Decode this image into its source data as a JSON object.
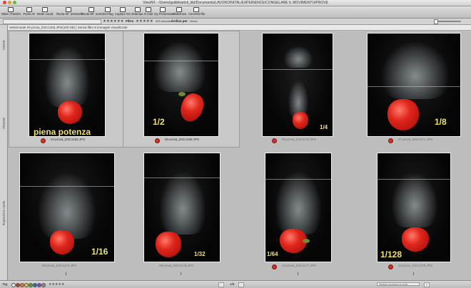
{
  "window": {
    "title": "ViewNX - /Users/guidebartoli_kbt/Documents/LAVORO/NITAL/EXPERIENCE/CONGELARE IL MOVIMENTO/PROVE"
  },
  "toolbar": {
    "buttons": [
      {
        "label": "Nikon Transfer",
        "icon": "transfer-icon"
      },
      {
        "label": "Punto AF",
        "icon": "af-point-icon"
      },
      {
        "label": "Mette vocali",
        "icon": "voice-memo-icon"
      },
      {
        "label": "Ruota 90° antiorario",
        "icon": "rotate-left-icon"
      },
      {
        "label": "Ruota 90° orario",
        "icon": "rotate-right-icon"
      },
      {
        "label": "GeoTag",
        "icon": "geotag-icon"
      },
      {
        "label": "Capture NX 2",
        "icon": "capture-nx-icon"
      },
      {
        "label": "Stampa",
        "icon": "print-icon"
      },
      {
        "label": "E-mail",
        "icon": "email-icon"
      },
      {
        "label": "my Picturetown",
        "icon": "picturetown-icon"
      },
      {
        "label": "Slideshow",
        "icon": "slideshow-icon"
      },
      {
        "label": "Convertit file",
        "icon": "convert-file-icon"
      }
    ]
  },
  "filterbar": {
    "stars": "★★★★★★",
    "filter_label": "Filtro",
    "filter_stars": "★★★★★",
    "filter_value": "005 unsorted",
    "sort_label": "Ordina per",
    "sort_value": "Nome"
  },
  "infobar": {
    "text": "Selezionate 04-prova_DSC1163.JPG(440 KB)  |  Senza filtro 8 immagini visualizzate"
  },
  "sidebar": {
    "tabs": [
      "Cartelle",
      "Metadati",
      "Regolazione rapida"
    ]
  },
  "thumbnails": [
    {
      "filename": "04-prova_DSC1163.JPG",
      "caption": "piena potenza",
      "selected": true,
      "dim": false
    },
    {
      "filename": "05-prova_DSC1169.JPG",
      "caption": "1/2",
      "selected": true,
      "dim": false
    },
    {
      "filename": "06-prova_DSC1170.JPG",
      "caption": "1/4",
      "selected": false,
      "dim": true
    },
    {
      "filename": "07-prova_DSC1171.JPG",
      "caption": "1/8",
      "selected": false,
      "dim": true
    },
    {
      "filename": "08-prova_DSC1174.JPG",
      "caption": "1/16",
      "selected": false,
      "dim": true
    },
    {
      "filename": "09-prova_DSC1175.JPG",
      "caption": "1/32",
      "selected": false,
      "dim": true
    },
    {
      "filename": "10-prova_DSC1177.JPG",
      "caption": "1/64",
      "selected": false,
      "dim": true
    },
    {
      "filename": "11-prova_DSC1178.JPG",
      "caption": "1/128",
      "selected": false,
      "dim": true
    }
  ],
  "statusbar": {
    "tag_label": "Tag",
    "page": "1/8",
    "status_placeholder": "Nessun processo in coda"
  },
  "colors": {
    "caption": "#f2e36a",
    "label_red": "#d3302a"
  }
}
